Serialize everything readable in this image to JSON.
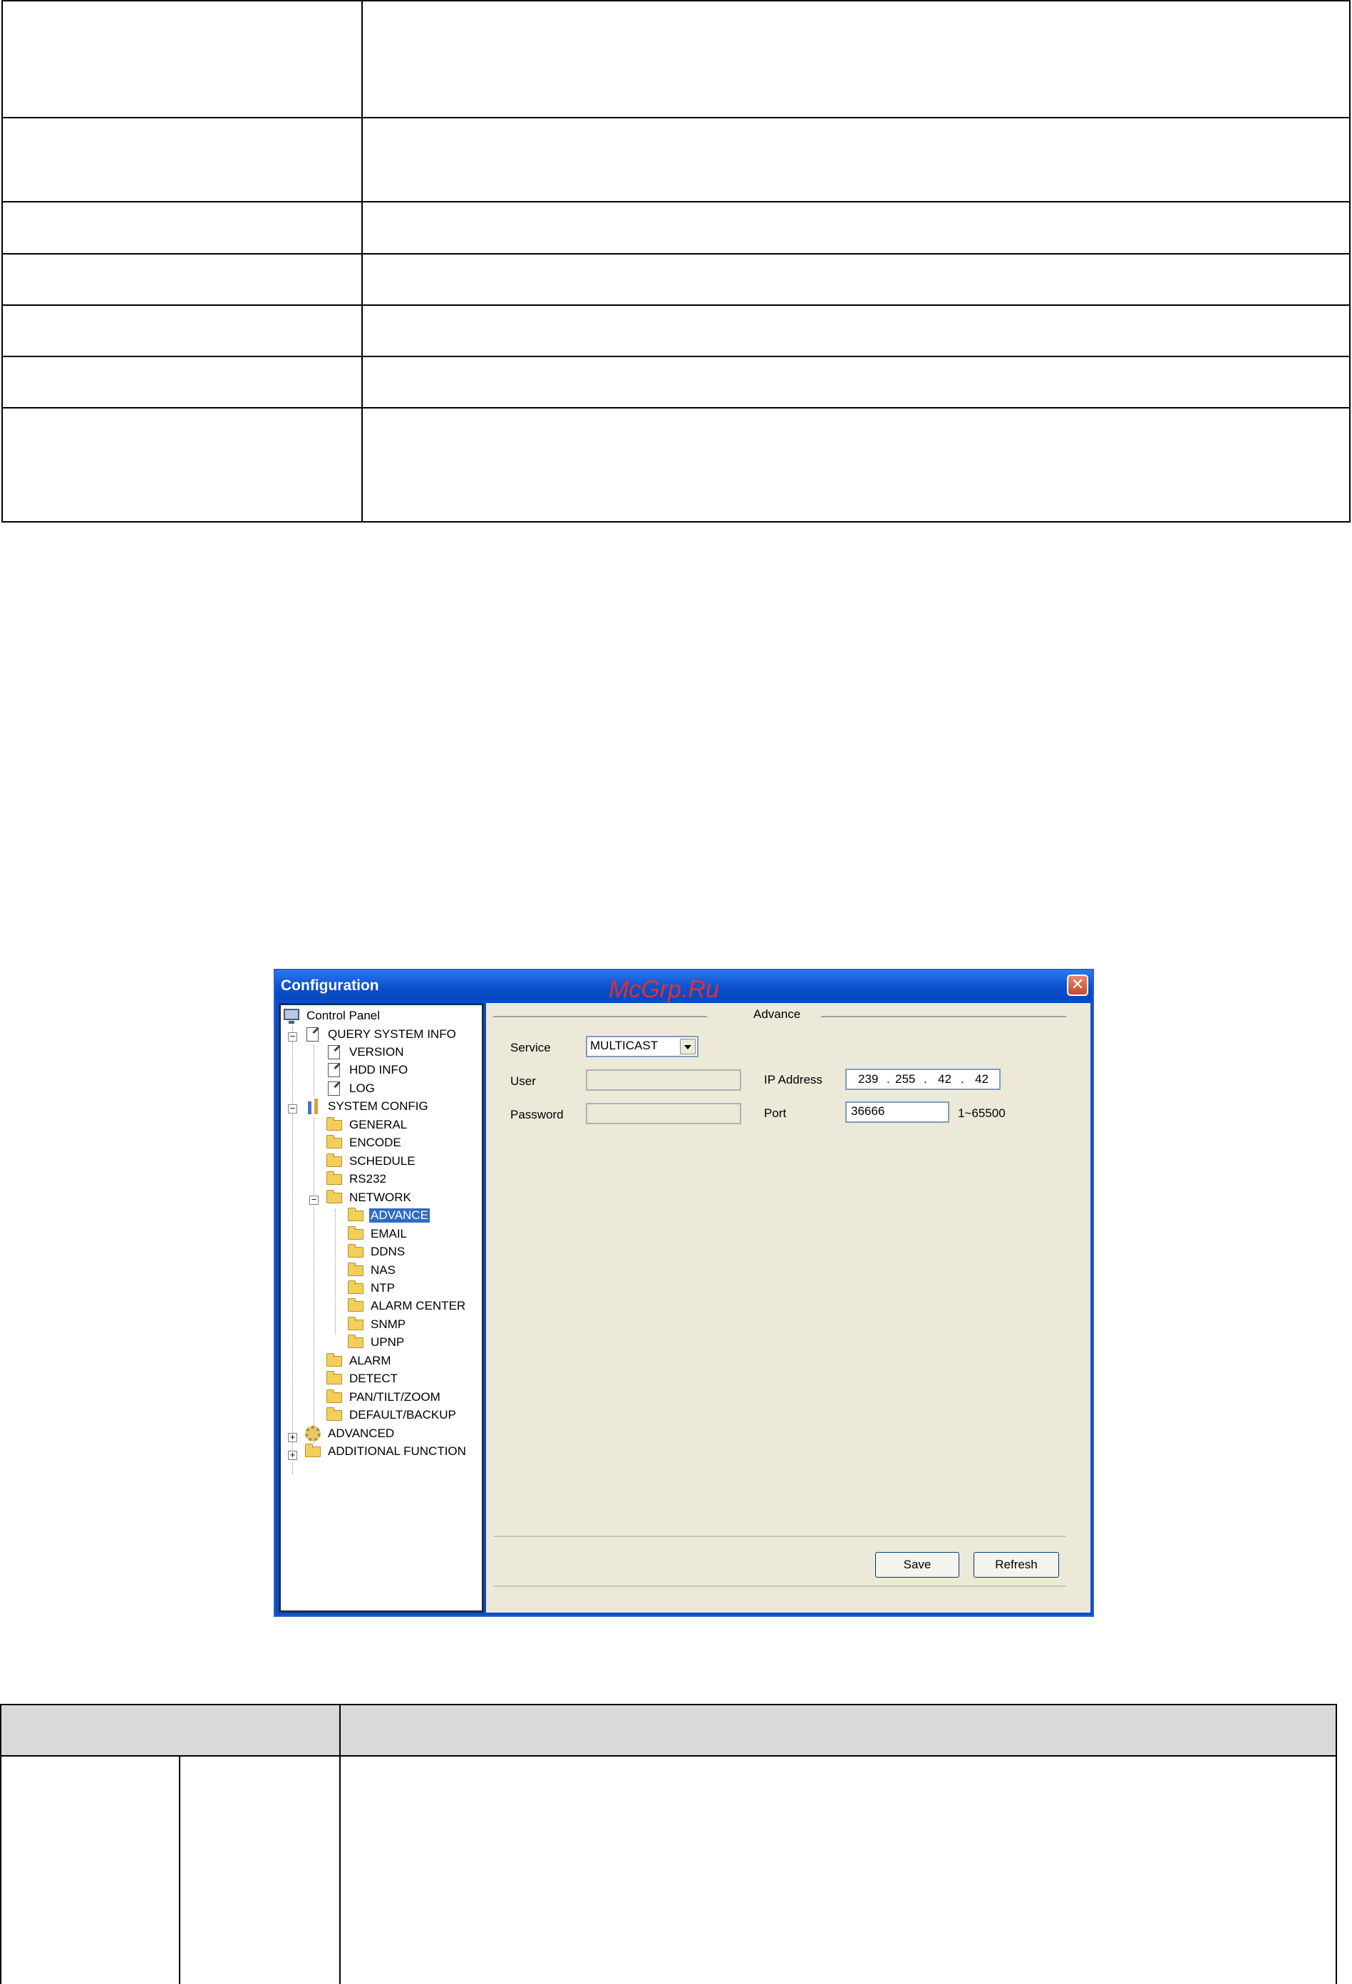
{
  "window": {
    "title": "Configuration",
    "watermark": "McGrp.Ru",
    "close_glyph": "✕"
  },
  "tree": {
    "items": [
      {
        "label": "Control Panel",
        "icon": "monitor-icon"
      },
      {
        "label": "QUERY SYSTEM INFO",
        "icon": "document-icon"
      },
      {
        "label": "VERSION",
        "icon": "document-icon"
      },
      {
        "label": "HDD INFO",
        "icon": "document-icon"
      },
      {
        "label": "LOG",
        "icon": "document-icon"
      },
      {
        "label": "SYSTEM CONFIG",
        "icon": "tools-icon"
      },
      {
        "label": "GENERAL",
        "icon": "folder-icon"
      },
      {
        "label": "ENCODE",
        "icon": "folder-icon"
      },
      {
        "label": "SCHEDULE",
        "icon": "folder-icon"
      },
      {
        "label": "RS232",
        "icon": "folder-icon"
      },
      {
        "label": "NETWORK",
        "icon": "folder-icon"
      },
      {
        "label": "ADVANCE",
        "icon": "open-folder-icon",
        "selected": true
      },
      {
        "label": "EMAIL",
        "icon": "folder-icon"
      },
      {
        "label": "DDNS",
        "icon": "folder-icon"
      },
      {
        "label": "NAS",
        "icon": "folder-icon"
      },
      {
        "label": "NTP",
        "icon": "folder-icon"
      },
      {
        "label": "ALARM CENTER",
        "icon": "folder-icon"
      },
      {
        "label": "SNMP",
        "icon": "folder-icon"
      },
      {
        "label": "UPNP",
        "icon": "folder-icon"
      },
      {
        "label": "ALARM",
        "icon": "folder-icon"
      },
      {
        "label": "DETECT",
        "icon": "folder-icon"
      },
      {
        "label": "PAN/TILT/ZOOM",
        "icon": "folder-icon"
      },
      {
        "label": "DEFAULT/BACKUP",
        "icon": "folder-icon"
      },
      {
        "label": "ADVANCED",
        "icon": "gears-icon"
      },
      {
        "label": "ADDITIONAL FUNCTION",
        "icon": "folder-icon"
      }
    ],
    "expanders": {
      "collapse": "−",
      "expand": "+"
    }
  },
  "content": {
    "group_title": "Advance",
    "service": {
      "label": "Service",
      "value": "MULTICAST"
    },
    "user": {
      "label": "User",
      "value": ""
    },
    "password": {
      "label": "Password",
      "value": ""
    },
    "ip_address": {
      "label": "IP Address",
      "octets": [
        "239",
        "255",
        "42",
        "42"
      ],
      "dot": "."
    },
    "port": {
      "label": "Port",
      "value": "36666",
      "range": "1~65500"
    },
    "save_label": "Save",
    "refresh_label": "Refresh"
  }
}
